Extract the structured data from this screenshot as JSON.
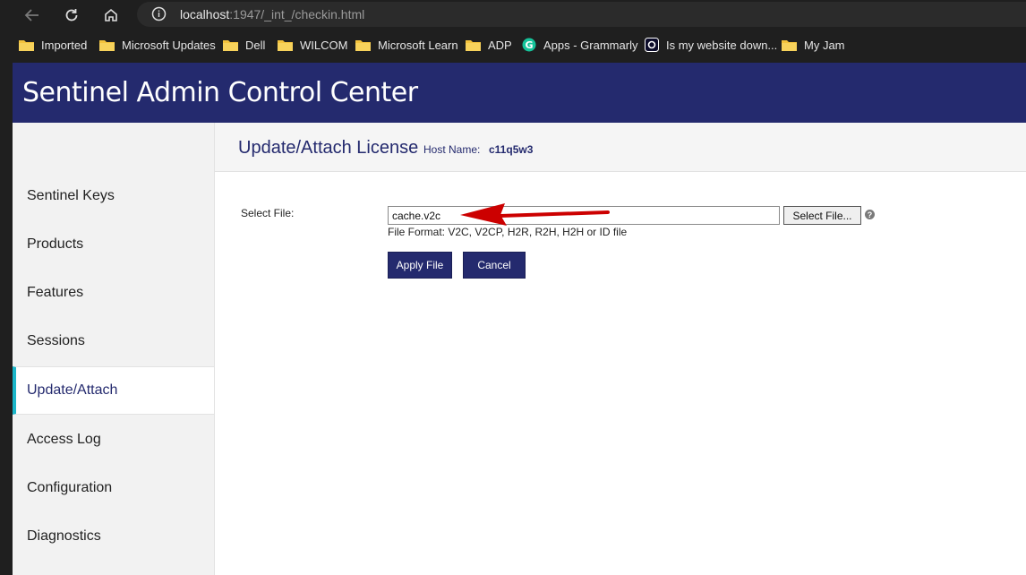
{
  "browser": {
    "url_host": "localhost",
    "url_rest": ":1947/_int_/checkin.html",
    "bookmarks": [
      {
        "label": "Imported",
        "icon": "folder-icon"
      },
      {
        "label": "Microsoft Updates",
        "icon": "folder-icon"
      },
      {
        "label": "Dell",
        "icon": "folder-icon"
      },
      {
        "label": "WILCOM",
        "icon": "folder-icon"
      },
      {
        "label": "Microsoft Learn",
        "icon": "folder-icon"
      },
      {
        "label": "ADP",
        "icon": "folder-icon"
      },
      {
        "label": "Apps - Grammarly",
        "icon": "grammarly-icon"
      },
      {
        "label": "Is my website down...",
        "icon": "website-status-icon"
      },
      {
        "label": "My Jam",
        "icon": "folder-icon"
      }
    ]
  },
  "app": {
    "title_light": "Sentinel ",
    "title_strong": "Admin Control Center",
    "header_color": "#242a6e",
    "accent_color": "#1bb6c9"
  },
  "sidebar": {
    "items": [
      {
        "label": "Sentinel Keys",
        "active": false
      },
      {
        "label": "Products",
        "active": false
      },
      {
        "label": "Features",
        "active": false
      },
      {
        "label": "Sessions",
        "active": false
      },
      {
        "label": "Update/Attach",
        "active": true
      },
      {
        "label": "Access Log",
        "active": false
      },
      {
        "label": "Configuration",
        "active": false
      },
      {
        "label": "Diagnostics",
        "active": false
      }
    ]
  },
  "main": {
    "title": "Update/Attach License",
    "host_label": "Host Name:",
    "host_value": "c11q5w3",
    "select_file_label": "Select File:",
    "file_value": "cache.v2c",
    "select_file_button": "Select File...",
    "help_glyph": "?",
    "file_format": "File Format: V2C, V2CP, H2R, R2H, H2H or ID file",
    "apply_button": "Apply File",
    "cancel_button": "Cancel"
  },
  "annotation": {
    "arrow_color": "#cc0000"
  }
}
